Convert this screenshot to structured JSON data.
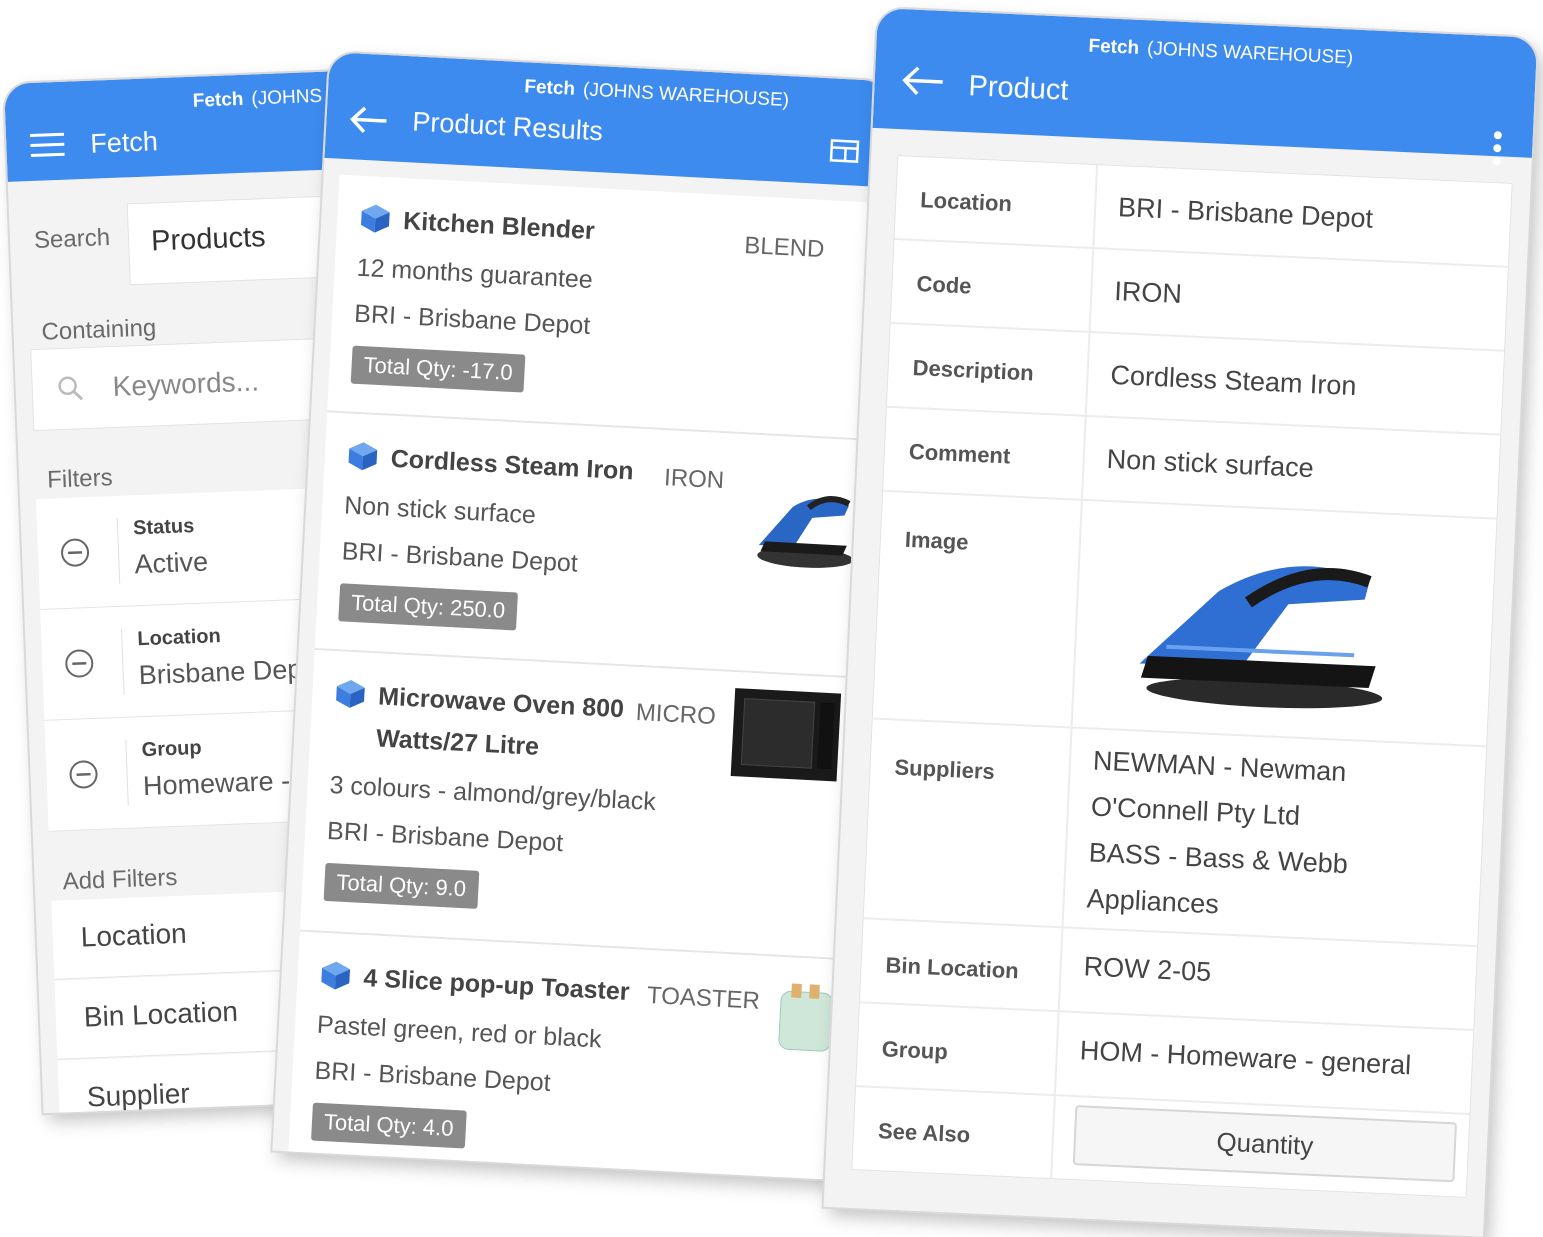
{
  "accent_color": "#3d8bef",
  "search_screen": {
    "app_name": "Fetch",
    "app_context": "(JOHNS WAREHOUSE)",
    "title": "Fetch",
    "search_label": "Search",
    "search_type": "Products",
    "containing_label": "Containing",
    "keywords_placeholder": "Keywords...",
    "filters_label": "Filters",
    "filters": [
      {
        "label": "Status",
        "value": "Active"
      },
      {
        "label": "Location",
        "value": "Brisbane Depot"
      },
      {
        "label": "Group",
        "value": "Homeware - general"
      }
    ],
    "add_filters_label": "Add Filters",
    "add_filters": [
      "Location",
      "Bin Location",
      "Supplier"
    ]
  },
  "results_screen": {
    "app_name": "Fetch",
    "app_context": "(JOHNS WAREHOUSE)",
    "title": "Product Results",
    "products": [
      {
        "name": "Kitchen Blender",
        "code": "BLEND",
        "comment": "12 months guarantee",
        "location": "BRI - Brisbane Depot",
        "qty": "Total Qty: -17.0",
        "image": "none"
      },
      {
        "name": "Cordless Steam Iron",
        "code": "IRON",
        "comment": "Non stick surface",
        "location": "BRI - Brisbane Depot",
        "qty": "Total Qty: 250.0",
        "image": "steam-iron"
      },
      {
        "name": "Microwave Oven 800 Watts/27 Litre",
        "code": "MICRO",
        "comment": "3 colours - almond/grey/black",
        "location": "BRI - Brisbane Depot",
        "qty": "Total Qty: 9.0",
        "image": "microwave"
      },
      {
        "name": "4 Slice pop-up Toaster",
        "code": "TOASTER",
        "comment": "Pastel green, red or black",
        "location": "BRI - Brisbane Depot",
        "qty": "Total Qty: 4.0",
        "image": "toaster"
      }
    ]
  },
  "product_screen": {
    "app_name": "Fetch",
    "app_context": "(JOHNS WAREHOUSE)",
    "title": "Product",
    "fields": {
      "location_label": "Location",
      "location": "BRI - Brisbane Depot",
      "code_label": "Code",
      "code": "IRON",
      "description_label": "Description",
      "description": "Cordless Steam Iron",
      "comment_label": "Comment",
      "comment": "Non stick surface",
      "image_label": "Image",
      "suppliers_label": "Suppliers",
      "suppliers": [
        "NEWMAN - Newman O'Connell Pty Ltd",
        "BASS - Bass & Webb Appliances"
      ],
      "bin_location_label": "Bin Location",
      "bin_location": "ROW 2-05",
      "group_label": "Group",
      "group": "HOM - Homeware - general",
      "see_also_label": "See Also",
      "see_also_button": "Quantity"
    }
  }
}
